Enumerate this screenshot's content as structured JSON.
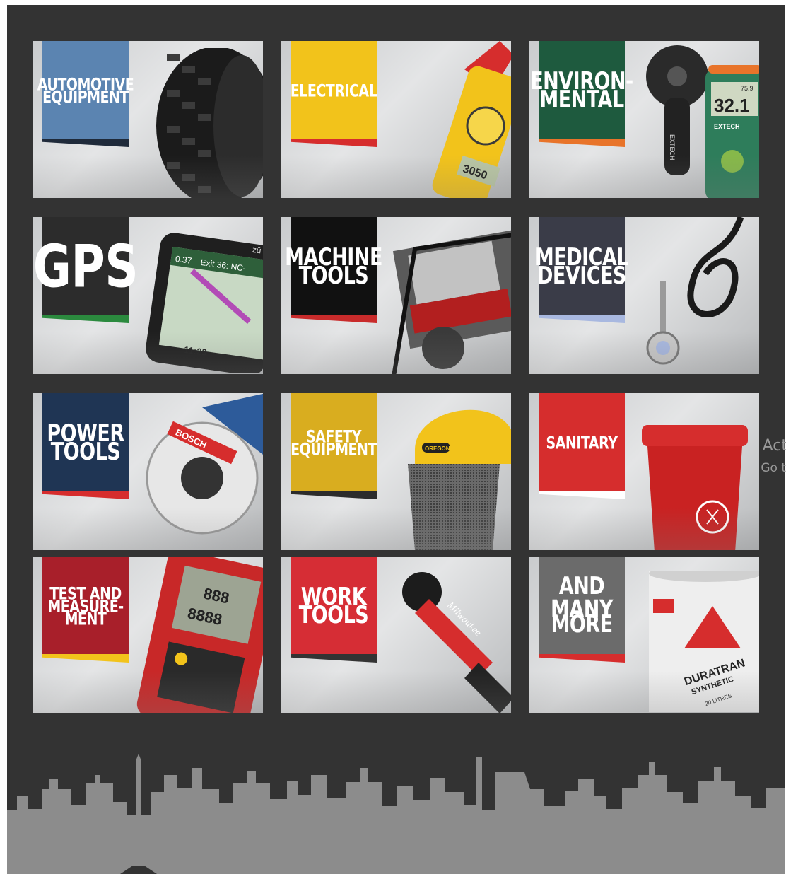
{
  "tiles": [
    {
      "id": "automotive",
      "lines": [
        "AUTOMOTIVE",
        "EQUIPMENT"
      ],
      "size": "small",
      "banner_color": "#5b84b1",
      "stripe_color": "#1f2a3a",
      "icon": "tyre-icon"
    },
    {
      "id": "electrical",
      "lines": [
        "ELECTRICAL"
      ],
      "size": "small",
      "banner_color": "#f2c31b",
      "stripe_color": "#d62d2d",
      "icon": "clamp-meter-icon"
    },
    {
      "id": "environmental",
      "lines": [
        "ENVIRON-",
        "MENTAL"
      ],
      "size": "mid",
      "banner_color": "#1e5a3e",
      "stripe_color": "#e8742a",
      "icon": "anemometer-icon"
    },
    {
      "id": "gps",
      "lines": [
        "GPS"
      ],
      "size": "big",
      "banner_color": "#2c2c2c",
      "stripe_color": "#2b8a3e",
      "icon": "gps-device-icon"
    },
    {
      "id": "machine-tools",
      "lines": [
        "MACHINE",
        "TOOLS"
      ],
      "size": "mid",
      "banner_color": "#111111",
      "stripe_color": "#c92b2b",
      "icon": "generator-icon"
    },
    {
      "id": "medical-devices",
      "lines": [
        "MEDICAL",
        "DEVICES"
      ],
      "size": "mid",
      "banner_color": "#3a3c48",
      "stripe_color": "#a8b8e0",
      "icon": "stethoscope-icon"
    },
    {
      "id": "power-tools",
      "lines": [
        "POWER",
        "TOOLS"
      ],
      "size": "mid",
      "banner_color": "#1f3554",
      "stripe_color": "#d62d2d",
      "icon": "circular-saw-icon"
    },
    {
      "id": "safety-equipment",
      "lines": [
        "SAFETY",
        "EQUIPMENT"
      ],
      "size": "small",
      "banner_color": "#d9ad1f",
      "stripe_color": "#2c2c2c",
      "icon": "hard-hat-icon"
    },
    {
      "id": "sanitary",
      "lines": [
        "SANITARY"
      ],
      "size": "small",
      "banner_color": "#d62d2d",
      "stripe_color": "#ffffff",
      "icon": "waste-bin-icon"
    },
    {
      "id": "test-measurement",
      "lines": [
        "TEST AND",
        "MEASURE-",
        "MENT"
      ],
      "size": "small",
      "banner_color": "#a81f2a",
      "stripe_color": "#f2c31b",
      "icon": "multimeter-icon"
    },
    {
      "id": "work-tools",
      "lines": [
        "WORK",
        "TOOLS"
      ],
      "size": "mid",
      "banner_color": "#d62d35",
      "stripe_color": "#333333",
      "icon": "pipe-cutter-icon"
    },
    {
      "id": "and-many-more",
      "lines": [
        "AND MANY",
        "MORE"
      ],
      "size": "mid",
      "banner_color": "#6b6b6b",
      "stripe_color": "#d62d2d",
      "icon": "oil-pail-icon"
    }
  ],
  "overlay": {
    "line1": "Act",
    "line2": "Go t"
  },
  "product_text": {
    "gps_distance": "0.37",
    "gps_exit": "Exit 36: NC-",
    "gps_time": "11:23",
    "gps_brand": "zū",
    "meter_reading": "3050",
    "anemo_reading": "32.1",
    "anemo_top": "75.9",
    "anemo_brand": "EXTECH",
    "saw_brand": "BOSCH",
    "cutter_brand": "Milwaukee",
    "pail_brand": "DURATRAN",
    "pail_sub": "SYNTHETIC",
    "pail_qty": "20 LITRES",
    "hat_brand": "OREGON"
  }
}
